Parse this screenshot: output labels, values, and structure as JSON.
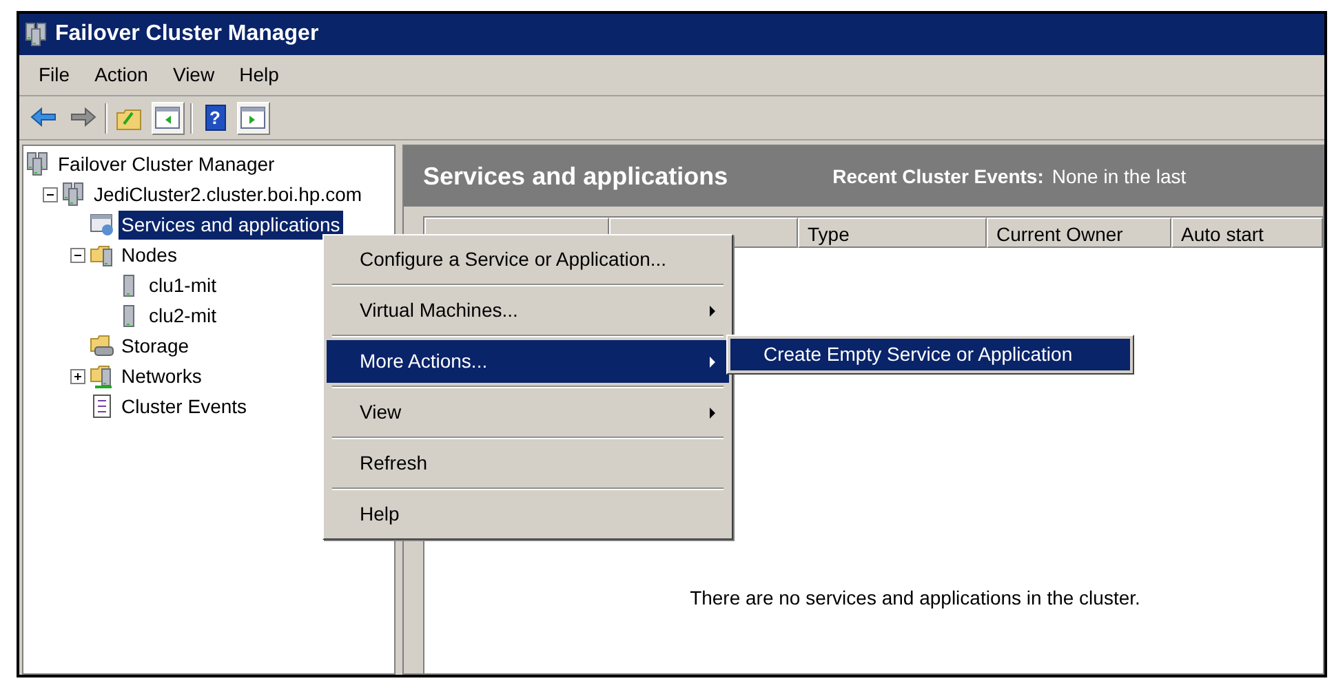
{
  "window": {
    "title": "Failover Cluster Manager"
  },
  "menu_bar": [
    "File",
    "Action",
    "View",
    "Help"
  ],
  "toolbar": [
    {
      "kind": "back",
      "pressed": false
    },
    {
      "kind": "forward",
      "pressed": false
    },
    {
      "kind": "separator"
    },
    {
      "kind": "up",
      "pressed": false
    },
    {
      "kind": "console-tree",
      "pressed": true
    },
    {
      "kind": "separator"
    },
    {
      "kind": "help",
      "label": "?",
      "pressed": false
    },
    {
      "kind": "action-pane",
      "pressed": true
    }
  ],
  "tree": [
    {
      "label": "Failover Cluster Manager",
      "kind": "manager",
      "selected": false,
      "children": [
        {
          "label": "JediCluster2.cluster.boi.hp.com",
          "kind": "cluster",
          "selected": false,
          "expanded": true,
          "children": [
            {
              "label": "Services and applications",
              "kind": "services",
              "selected": true
            },
            {
              "label": "Nodes",
              "kind": "nodes",
              "selected": false,
              "expanded": true,
              "children": [
                {
                  "label": "clu1-mit",
                  "kind": "server",
                  "selected": false
                },
                {
                  "label": "clu2-mit",
                  "kind": "server",
                  "selected": false
                }
              ]
            },
            {
              "label": "Storage",
              "kind": "storage",
              "selected": false
            },
            {
              "label": "Networks",
              "kind": "networks",
              "selected": false,
              "expanded": false
            },
            {
              "label": "Cluster Events",
              "kind": "events",
              "selected": false
            }
          ]
        }
      ]
    }
  ],
  "right_pane": {
    "title": "Services and applications",
    "recent_events_label": "Recent Cluster Events:",
    "recent_events_value": "None in the last",
    "columns": [
      "Type",
      "Current Owner",
      "Auto start"
    ],
    "empty_message": "There are no services and applications in the cluster."
  },
  "context_menu": {
    "items": [
      {
        "label": "Configure a Service or Application...",
        "submenu": false,
        "selected": false
      },
      {
        "label": "Virtual Machines...",
        "submenu": true,
        "selected": false
      },
      {
        "label": "More Actions...",
        "submenu": true,
        "selected": true
      },
      {
        "label": "View",
        "submenu": true,
        "selected": false
      },
      {
        "label": "Refresh",
        "submenu": false,
        "selected": false
      },
      {
        "label": "Help",
        "submenu": false,
        "selected": false
      }
    ],
    "submenu_items": [
      {
        "label": "Create Empty Service or Application",
        "selected": true
      }
    ]
  }
}
